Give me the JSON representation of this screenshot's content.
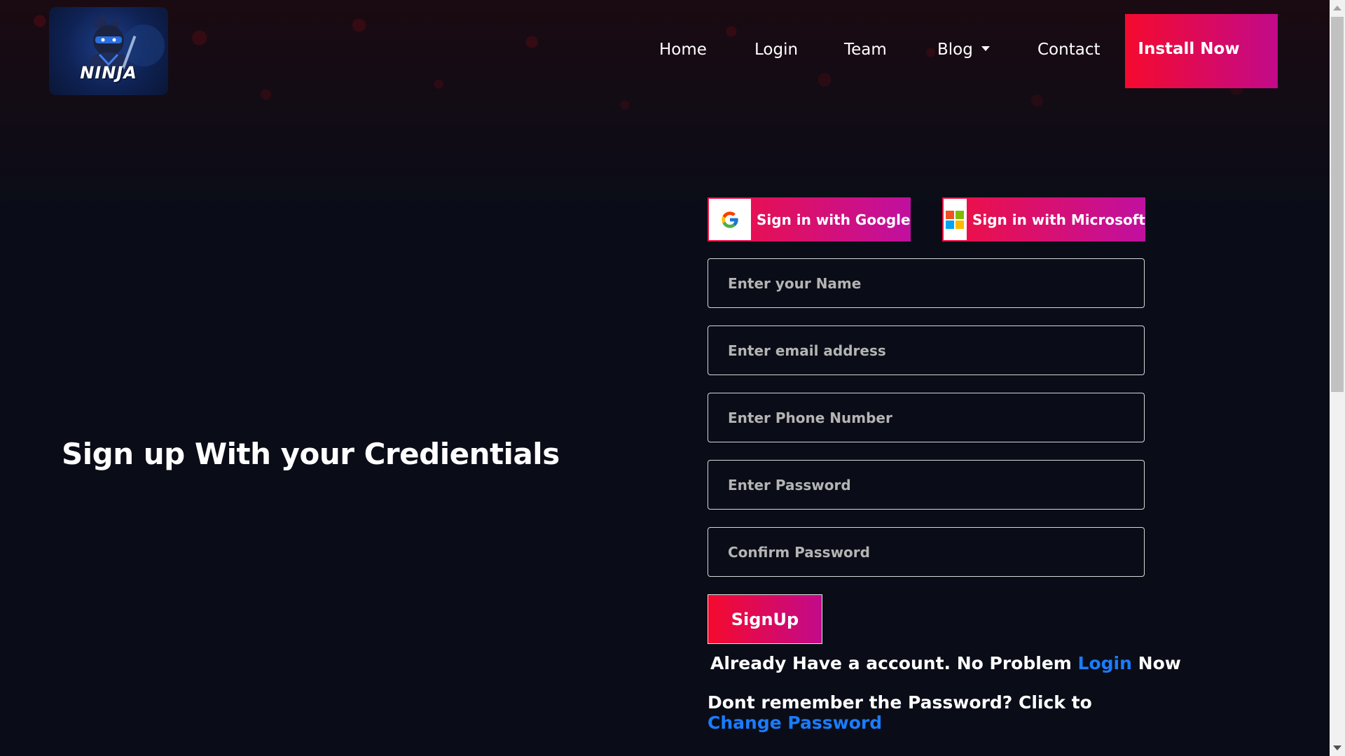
{
  "logo": {
    "text": "NINJA"
  },
  "nav": {
    "items": [
      "Home",
      "Login",
      "Team",
      "Blog",
      "Contact"
    ],
    "install_label": "Install Now"
  },
  "hero": {
    "headline": "Sign up With your Credientials"
  },
  "social": {
    "google_label": "Sign in with Google",
    "microsoft_label": "Sign in with Microsoft"
  },
  "form": {
    "name_placeholder": "Enter your Name",
    "email_placeholder": "Enter email address",
    "phone_placeholder": "Enter Phone Number",
    "password_placeholder": "Enter Password",
    "confirm_placeholder": "Confirm Password",
    "signup_label": "SignUp"
  },
  "footer_links": {
    "login_prefix": "Already Have a account. No Problem",
    "login_link": "Login",
    "login_suffix": "Now",
    "reset_prefix": "Dont remember the Password? Click to",
    "reset_link": "Change Password"
  },
  "colors": {
    "background": "#0a0d17",
    "accent_start": "#f50a2e",
    "accent_end": "#c20a8a",
    "link": "#1a7cff"
  }
}
